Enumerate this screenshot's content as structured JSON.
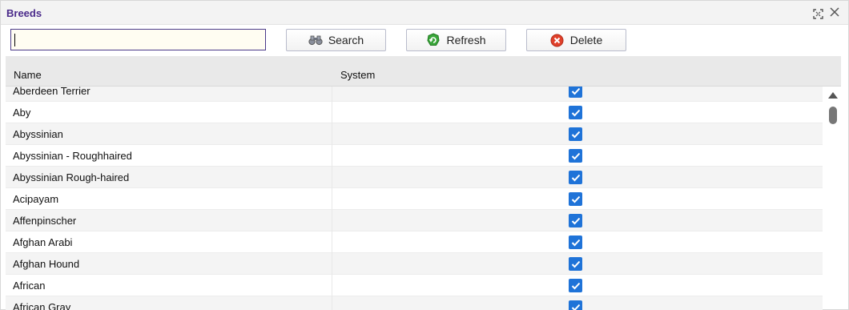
{
  "window": {
    "title": "Breeds"
  },
  "toolbar": {
    "search_value": "",
    "search_label": "Search",
    "refresh_label": "Refresh",
    "delete_label": "Delete"
  },
  "grid": {
    "columns": [
      "Name",
      "System"
    ],
    "rows": [
      {
        "name": "Aberdeen Terrier",
        "system": true
      },
      {
        "name": "Aby",
        "system": true
      },
      {
        "name": "Abyssinian",
        "system": true
      },
      {
        "name": "Abyssinian - Roughhaired",
        "system": true
      },
      {
        "name": "Abyssinian Rough-haired",
        "system": true
      },
      {
        "name": "Acipayam",
        "system": true
      },
      {
        "name": "Affenpinscher",
        "system": true
      },
      {
        "name": "Afghan Arabi",
        "system": true
      },
      {
        "name": "Afghan Hound",
        "system": true
      },
      {
        "name": "African",
        "system": true
      },
      {
        "name": "African Gray",
        "system": true
      }
    ]
  },
  "icons": {
    "expand": "expand-icon",
    "close": "close-icon",
    "search": "binoculars-icon",
    "refresh": "refresh-icon",
    "delete": "delete-icon"
  },
  "colors": {
    "title": "#4a2a8a",
    "checkbox": "#1f73d8",
    "refresh_icon": "#3aa63a",
    "delete_icon": "#e0402a"
  }
}
